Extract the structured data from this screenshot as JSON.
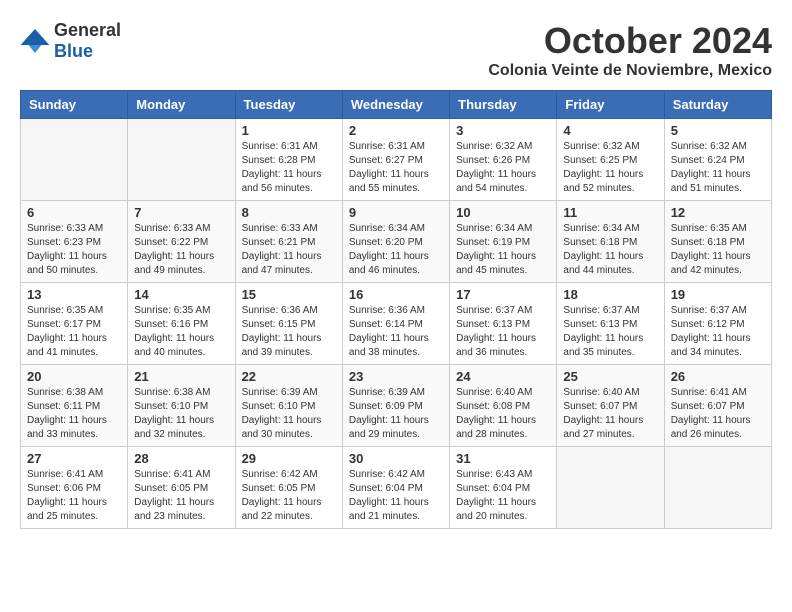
{
  "header": {
    "logo_general": "General",
    "logo_blue": "Blue",
    "month": "October 2024",
    "location": "Colonia Veinte de Noviembre, Mexico"
  },
  "days_of_week": [
    "Sunday",
    "Monday",
    "Tuesday",
    "Wednesday",
    "Thursday",
    "Friday",
    "Saturday"
  ],
  "weeks": [
    [
      {
        "day": "",
        "info": ""
      },
      {
        "day": "",
        "info": ""
      },
      {
        "day": "1",
        "info": "Sunrise: 6:31 AM\nSunset: 6:28 PM\nDaylight: 11 hours and 56 minutes."
      },
      {
        "day": "2",
        "info": "Sunrise: 6:31 AM\nSunset: 6:27 PM\nDaylight: 11 hours and 55 minutes."
      },
      {
        "day": "3",
        "info": "Sunrise: 6:32 AM\nSunset: 6:26 PM\nDaylight: 11 hours and 54 minutes."
      },
      {
        "day": "4",
        "info": "Sunrise: 6:32 AM\nSunset: 6:25 PM\nDaylight: 11 hours and 52 minutes."
      },
      {
        "day": "5",
        "info": "Sunrise: 6:32 AM\nSunset: 6:24 PM\nDaylight: 11 hours and 51 minutes."
      }
    ],
    [
      {
        "day": "6",
        "info": "Sunrise: 6:33 AM\nSunset: 6:23 PM\nDaylight: 11 hours and 50 minutes."
      },
      {
        "day": "7",
        "info": "Sunrise: 6:33 AM\nSunset: 6:22 PM\nDaylight: 11 hours and 49 minutes."
      },
      {
        "day": "8",
        "info": "Sunrise: 6:33 AM\nSunset: 6:21 PM\nDaylight: 11 hours and 47 minutes."
      },
      {
        "day": "9",
        "info": "Sunrise: 6:34 AM\nSunset: 6:20 PM\nDaylight: 11 hours and 46 minutes."
      },
      {
        "day": "10",
        "info": "Sunrise: 6:34 AM\nSunset: 6:19 PM\nDaylight: 11 hours and 45 minutes."
      },
      {
        "day": "11",
        "info": "Sunrise: 6:34 AM\nSunset: 6:18 PM\nDaylight: 11 hours and 44 minutes."
      },
      {
        "day": "12",
        "info": "Sunrise: 6:35 AM\nSunset: 6:18 PM\nDaylight: 11 hours and 42 minutes."
      }
    ],
    [
      {
        "day": "13",
        "info": "Sunrise: 6:35 AM\nSunset: 6:17 PM\nDaylight: 11 hours and 41 minutes."
      },
      {
        "day": "14",
        "info": "Sunrise: 6:35 AM\nSunset: 6:16 PM\nDaylight: 11 hours and 40 minutes."
      },
      {
        "day": "15",
        "info": "Sunrise: 6:36 AM\nSunset: 6:15 PM\nDaylight: 11 hours and 39 minutes."
      },
      {
        "day": "16",
        "info": "Sunrise: 6:36 AM\nSunset: 6:14 PM\nDaylight: 11 hours and 38 minutes."
      },
      {
        "day": "17",
        "info": "Sunrise: 6:37 AM\nSunset: 6:13 PM\nDaylight: 11 hours and 36 minutes."
      },
      {
        "day": "18",
        "info": "Sunrise: 6:37 AM\nSunset: 6:13 PM\nDaylight: 11 hours and 35 minutes."
      },
      {
        "day": "19",
        "info": "Sunrise: 6:37 AM\nSunset: 6:12 PM\nDaylight: 11 hours and 34 minutes."
      }
    ],
    [
      {
        "day": "20",
        "info": "Sunrise: 6:38 AM\nSunset: 6:11 PM\nDaylight: 11 hours and 33 minutes."
      },
      {
        "day": "21",
        "info": "Sunrise: 6:38 AM\nSunset: 6:10 PM\nDaylight: 11 hours and 32 minutes."
      },
      {
        "day": "22",
        "info": "Sunrise: 6:39 AM\nSunset: 6:10 PM\nDaylight: 11 hours and 30 minutes."
      },
      {
        "day": "23",
        "info": "Sunrise: 6:39 AM\nSunset: 6:09 PM\nDaylight: 11 hours and 29 minutes."
      },
      {
        "day": "24",
        "info": "Sunrise: 6:40 AM\nSunset: 6:08 PM\nDaylight: 11 hours and 28 minutes."
      },
      {
        "day": "25",
        "info": "Sunrise: 6:40 AM\nSunset: 6:07 PM\nDaylight: 11 hours and 27 minutes."
      },
      {
        "day": "26",
        "info": "Sunrise: 6:41 AM\nSunset: 6:07 PM\nDaylight: 11 hours and 26 minutes."
      }
    ],
    [
      {
        "day": "27",
        "info": "Sunrise: 6:41 AM\nSunset: 6:06 PM\nDaylight: 11 hours and 25 minutes."
      },
      {
        "day": "28",
        "info": "Sunrise: 6:41 AM\nSunset: 6:05 PM\nDaylight: 11 hours and 23 minutes."
      },
      {
        "day": "29",
        "info": "Sunrise: 6:42 AM\nSunset: 6:05 PM\nDaylight: 11 hours and 22 minutes."
      },
      {
        "day": "30",
        "info": "Sunrise: 6:42 AM\nSunset: 6:04 PM\nDaylight: 11 hours and 21 minutes."
      },
      {
        "day": "31",
        "info": "Sunrise: 6:43 AM\nSunset: 6:04 PM\nDaylight: 11 hours and 20 minutes."
      },
      {
        "day": "",
        "info": ""
      },
      {
        "day": "",
        "info": ""
      }
    ]
  ]
}
